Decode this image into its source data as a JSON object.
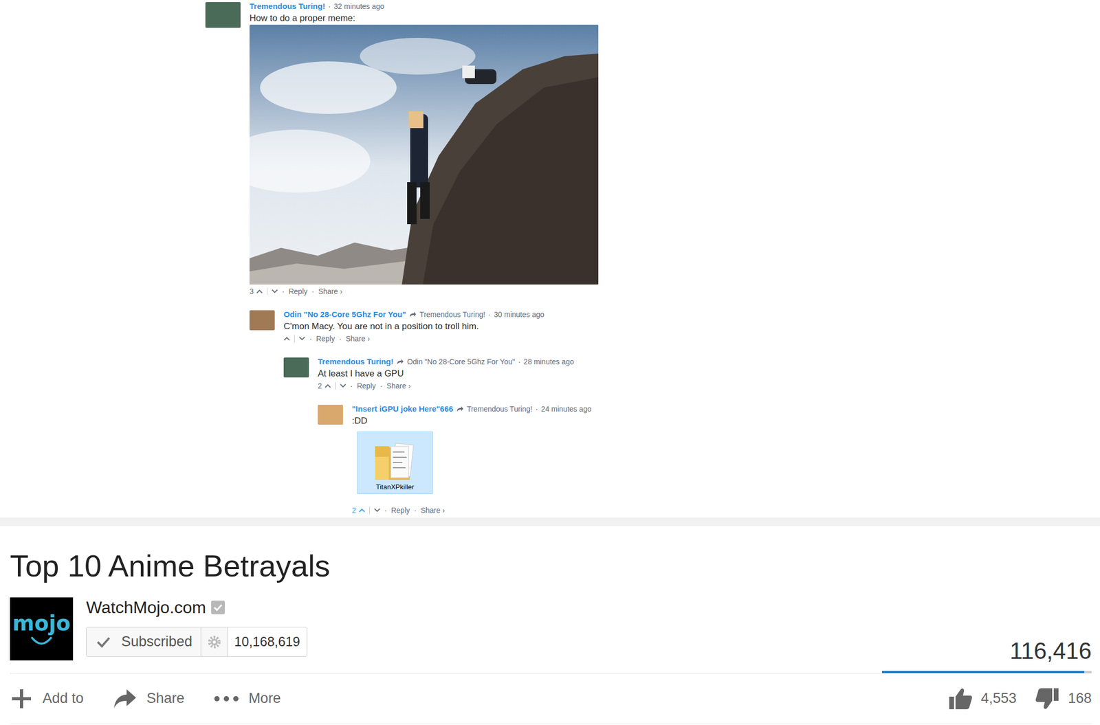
{
  "thread": {
    "separator": "·",
    "comments": [
      {
        "author": "Tremendous Turing!",
        "time": "32 minutes ago",
        "text": "How to do a proper meme:",
        "avatar_color": "#4a6b57",
        "attachment": {
          "kind": "photo"
        },
        "likes": "3",
        "upvoted": false,
        "actions": [
          "Reply",
          "Share ›"
        ],
        "replies": [
          {
            "author": "Odin \"No 28-Core 5Ghz For You\"",
            "reply_to": "Tremendous Turing!",
            "time": "30 minutes ago",
            "text": "C'mon Macy. You are not in a position to troll him.",
            "avatar_color": "#a07a55",
            "upvoted": false,
            "actions": [
              "Reply",
              "Share ›"
            ],
            "replies": [
              {
                "author": "Tremendous Turing!",
                "reply_to": "Odin \"No 28-Core 5Ghz For You\"",
                "time": "28 minutes ago",
                "text": "At least I have a GPU",
                "avatar_color": "#4a6b57",
                "likes": "2",
                "upvoted": false,
                "actions": [
                  "Reply",
                  "Share ›"
                ],
                "replies": [
                  {
                    "author": "\"Insert iGPU joke Here\"666",
                    "reply_to": "Tremendous Turing!",
                    "time": "24 minutes ago",
                    "text": ":DD",
                    "avatar_color": "#d9a86c",
                    "attachment": {
                      "kind": "folder",
                      "label": "TitanXPkiller",
                      "selected": true
                    },
                    "likes": "2",
                    "upvoted": true,
                    "actions": [
                      "Reply",
                      "Share ›"
                    ],
                    "replies": []
                  }
                ]
              }
            ]
          }
        ]
      }
    ]
  },
  "video": {
    "title": "Top 10 Anime Betrayals",
    "channel": {
      "name": "WatchMojo.com",
      "logo_text": "mojo",
      "verified": true
    },
    "subscribe": {
      "label": "Subscribed",
      "subscribed": true,
      "count": "10,168,619"
    },
    "views": "116,416",
    "sentiment": {
      "level": 0.964
    },
    "actions": [
      "Add to",
      "Share",
      "More"
    ],
    "likes": "4,553",
    "dislikes": "168"
  }
}
